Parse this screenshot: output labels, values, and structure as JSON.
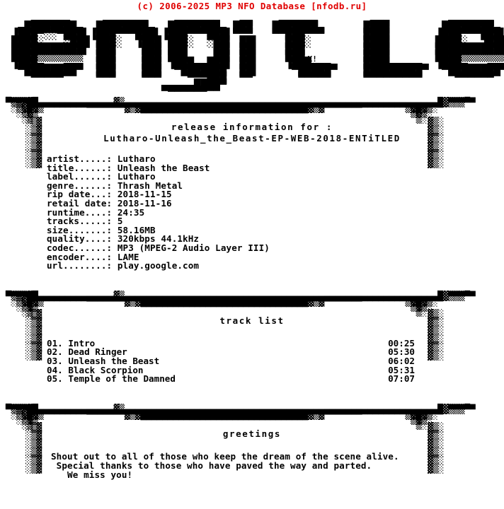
{
  "header": {
    "copyright": "(c) 2006-2025 MP3 NFO Database [nfodb.ru]",
    "color": "#e00000"
  },
  "logo": {
    "group_name": "ENTiTLED",
    "artist_signature": "hX!",
    "art": [
      "   ▄▄▄▄▄▄     ▄▄▄▄▄▄▄    ▄▄▄▄▄▄▄   ▄▄    ▄▄▄▄▄▄        ▄▄▄         ▄▄▄▄▄▄▄    ▄▄▄▄▄▄▄▄",
      " ▄████████▄  ████████▄  ████████▄ ███   ███████▄      ████        ████████▄  ██████████▄",
      "▐███▀░░▀███▌▐███▀▀▀███▌▐███▀▀▀███▌▀▀▀   ▀▀███▀▀▀      ████       ▐███▀▀▀███▌▐███▀▀▀▀███▌",
      "████░   ░███ ███░  ▐███ ███░  ░██▌ ██▌    ███░        ████       ████░  ▐███ ███░   ▐███",
      "███████████▌ ███    ███ ███    ██▌ ██▌    ███         ████       ███████████ ███     ███",
      "████▒▒▒▒▒▒▒  ███    ███ ███    ██▌ ██▌    ███         ████       ████▒▒▒▒▒▒▒ ███     ███",
      "▐███▄   ▄▄▄  ███    ███ ▐███▄▄███▌ ██▌    ▐███▄▄▄     ████▄▄▄▄▄  ▐███▄   ▄▄▄ ███▄   ▄███",
      " ▀████████▀  ███    ███  ▀███████  ██▌     ▀█████▀    █████████▀  ▀████████▀ ██████████▀",
      "   ▀▀▀▀▀     ▀▀▀    ▀▀▀    ▀▀▀███  ▀▀       ▀▀▀▀▀     ▀▀▀▀▀▀▀▀▀     ▀▀▀▀▀▀   ▀▀▀▀▀▀▀▀",
      "                       ▄▄▄▄▄████▀",
      "                        ▀▀▀▀▀▀"
    ]
  },
  "separator": {
    "art": [
      "▄▄▄▄▄                                                                             ▄▄▄▄▄",
      "▀▒▒▒▓█▄▄▄▄▄▄▄▄▄▄▄▄▄▄▓▒▄▄▄▄▄▄▄▄▄▄▄▄▄▄▄▄▄▄▄▄▄▄▄▄▄▄▄▄▄▄▄▄▄▄▄▄▄▄▄▄▄▄▄▄▄▄▄▄▄▄▄▄▄▄▄▄▄▄█▓▒▒▒▀",
      " ░▒▓█▓▒        ▀▀▀▀▀▀▀▓▒▓███████████████████████████████▓▒▓▀▀▀▀▀▀▀        ▒▓█▓▒░",
      "  ░▒▓▒                                                                     ▒▓▒░",
      "   ░▒                                                                       ▒░"
    ]
  },
  "rails": {
    "left": [
      "░▒▓",
      "░▒▓",
      "░▒▓",
      "░▒▓",
      "░▒▓",
      "░▒▓"
    ],
    "right": [
      "▓▒░",
      "▓▒░",
      "▓▒░",
      "▓▒░",
      "▓▒░",
      "▓▒░"
    ]
  },
  "release": {
    "heading_line1": "release information for :",
    "heading_line2": "Lutharo-Unleash_the_Beast-EP-WEB-2018-ENTiTLED",
    "fields": [
      {
        "label": "artist.....:",
        "value": "Lutharo"
      },
      {
        "label": "title......:",
        "value": "Unleash the Beast"
      },
      {
        "label": "label......:",
        "value": "Lutharo"
      },
      {
        "label": "genre......:",
        "value": "Thrash Metal"
      },
      {
        "label": "rip date...:",
        "value": "2018-11-15"
      },
      {
        "label": "retail date:",
        "value": "2018-11-16"
      },
      {
        "label": "runtime....:",
        "value": "24:35"
      },
      {
        "label": "tracks.....:",
        "value": "5"
      },
      {
        "label": "size.......:",
        "value": "58.16MB"
      },
      {
        "label": "quality....:",
        "value": "320kbps 44.1kHz"
      },
      {
        "label": "codec......:",
        "value": "MP3 (MPEG-2 Audio Layer III)"
      },
      {
        "label": "encoder....:",
        "value": "LAME"
      },
      {
        "label": "url........:",
        "value": "play.google.com"
      }
    ],
    "info_text": "artist.....: Lutharo\ntitle......: Unleash the Beast\nlabel......: Lutharo\ngenre......: Thrash Metal\nrip date...: 2018-11-15\nretail date: 2018-11-16\nruntime....: 24:35\ntracks.....: 5\nsize.......: 58.16MB\nquality....: 320kbps 44.1kHz\ncodec......: MP3 (MPEG-2 Audio Layer III)\nencoder....: LAME\nurl........: play.google.com"
  },
  "tracklist": {
    "heading": "track list",
    "tracks": [
      {
        "number": "01.",
        "title": "Intro",
        "time": "00:25"
      },
      {
        "number": "02.",
        "title": "Dead Ringer",
        "time": "05:30"
      },
      {
        "number": "03.",
        "title": "Unleash the Beast",
        "time": "06:02"
      },
      {
        "number": "04.",
        "title": "Black Scorpion",
        "time": "05:31"
      },
      {
        "number": "05.",
        "title": "Temple of the Damned",
        "time": "07:07"
      }
    ]
  },
  "greetings": {
    "heading": "greetings",
    "line1": "Shout out to all of those who keep the dream of the scene alive.",
    "line2": " Special thanks to those who have paved the way and parted.",
    "line3": "   We miss you!",
    "text": "Shout out to all of those who keep the dream of the scene alive.\n Special thanks to those who have paved the way and parted.\n   We miss you!"
  }
}
